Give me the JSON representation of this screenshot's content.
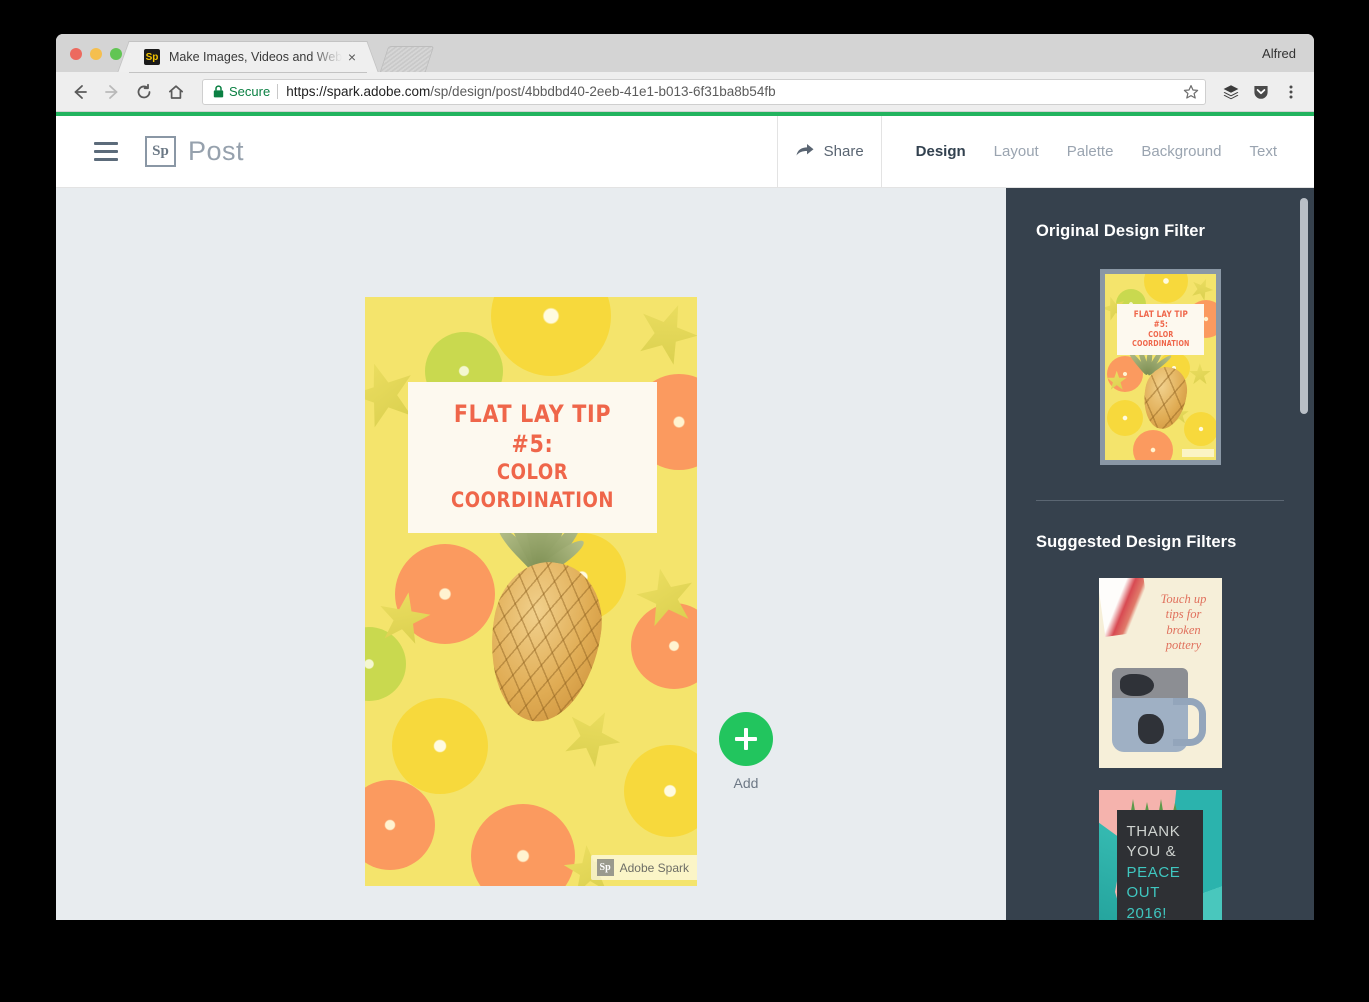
{
  "browser": {
    "profile_name": "Alfred",
    "tab": {
      "title": "Make Images, Videos and Web",
      "favicon_label": "Sp",
      "close_label": "×"
    },
    "toolbar": {
      "back_icon": "back-arrow-icon",
      "forward_icon": "forward-arrow-icon",
      "reload_icon": "reload-icon",
      "home_icon": "home-icon",
      "secure_label": "Secure",
      "url_scheme": "https://",
      "url_host": "spark.adobe.com",
      "url_path": "/sp/design/post/4bbdbd40-2eeb-41e1-b013-6f31ba8b54fb",
      "star_icon": "bookmark-star-icon",
      "extension_icon": "layers-extension-icon",
      "pocket_icon": "pocket-icon",
      "menu_icon": "three-dot-menu-icon"
    },
    "loading_bar_color": "#22b35e"
  },
  "app": {
    "header": {
      "menu_icon": "hamburger-menu-icon",
      "logo_label": "Sp",
      "title": "Post",
      "share_label": "Share",
      "share_icon": "share-arrow-icon"
    },
    "tabs": [
      {
        "label": "Design",
        "active": true
      },
      {
        "label": "Layout",
        "active": false
      },
      {
        "label": "Palette",
        "active": false
      },
      {
        "label": "Background",
        "active": false
      },
      {
        "label": "Text",
        "active": false
      }
    ],
    "canvas": {
      "design": {
        "headline_line1": "FLAT LAY TIP #5:",
        "headline_line2": "COLOR COORDINATION",
        "text_color": "#ef664a",
        "band_color": "#fdf9ef",
        "background_color": "#f4e46c",
        "watermark_logo": "Sp",
        "watermark_text": "Adobe Spark"
      },
      "add_button": {
        "label": "Add",
        "icon": "plus-icon",
        "color": "#22c55e"
      }
    },
    "sidebar": {
      "background_color": "#36414d",
      "original_section_title": "Original Design Filter",
      "suggested_section_title": "Suggested Design Filters",
      "original_filter": {
        "name": "citrus-flat-lay",
        "headline_line1": "FLAT LAY TIP #5:",
        "headline_line2": "COLOR COORDINATION",
        "selected": true
      },
      "suggested_filters": [
        {
          "name": "broken-pottery",
          "text_lines": [
            "Touch up",
            "tips for",
            "broken",
            "pottery"
          ],
          "text_color": "#e0705c",
          "background_color": "#f6efd9"
        },
        {
          "name": "thank-you-peace-out",
          "text_lines": [
            "THANK",
            "YOU &",
            "PEACE",
            "OUT",
            "2016!"
          ],
          "text_color": "#cfd3d0",
          "accent_color": "#3fc7c0",
          "background_color": "#f5b3ad"
        }
      ]
    }
  }
}
